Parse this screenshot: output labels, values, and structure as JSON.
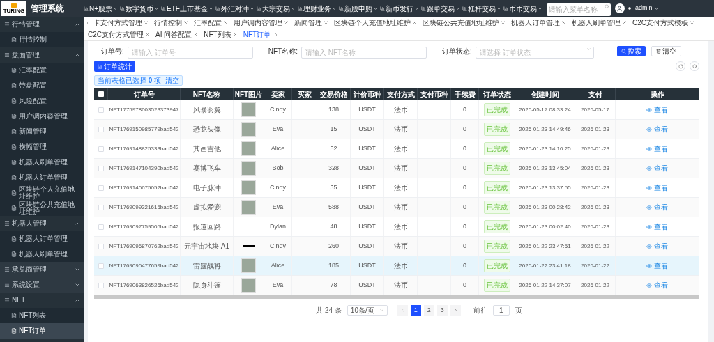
{
  "app": {
    "logo_text": "TURING",
    "title": "管理系统"
  },
  "top_nav": [
    {
      "label": "N+股票"
    },
    {
      "label": "数字货币"
    },
    {
      "label": "ETF上市基金"
    },
    {
      "label": "外汇对冲"
    },
    {
      "label": "大宗交易"
    },
    {
      "label": "理财业务"
    },
    {
      "label": "新股申购"
    },
    {
      "label": "新币发行"
    },
    {
      "label": "跟单交易"
    },
    {
      "label": "杠杆交易"
    },
    {
      "label": "币币交易"
    }
  ],
  "menu_search": {
    "placeholder": "请输入菜单名称"
  },
  "user": {
    "name": "admin"
  },
  "sidebar": {
    "items": [
      {
        "label": "行情管理",
        "expanded": true,
        "children": [
          {
            "label": "行情控制",
            "selected": false
          }
        ]
      },
      {
        "label": "盘面管理",
        "expanded": true,
        "children": [
          {
            "label": "汇率配置",
            "selected": false
          },
          {
            "label": "带盘配置",
            "selected": false
          },
          {
            "label": "风险配置",
            "selected": false
          },
          {
            "label": "用户调内容管理",
            "selected": false
          },
          {
            "label": "新闻管理",
            "selected": false
          },
          {
            "label": "横幅管理",
            "selected": false
          },
          {
            "label": "机器人刷单管理",
            "selected": false
          },
          {
            "label": "机器人订单管理",
            "selected": false
          },
          {
            "label": "区块链个人充值地址维护",
            "selected": false
          },
          {
            "label": "区块链公共充值地址维护",
            "selected": false
          }
        ]
      },
      {
        "label": "机器人管理",
        "expanded": true,
        "children": [
          {
            "label": "机器人订单管理",
            "selected": false
          },
          {
            "label": "机器人刷单管理",
            "selected": false
          }
        ]
      },
      {
        "label": "承兑商管理",
        "expanded": false
      },
      {
        "label": "系统设置",
        "expanded": false
      },
      {
        "label": "NFT",
        "expanded": true,
        "children": [
          {
            "label": "NFT列表",
            "selected": false
          },
          {
            "label": "NFT订单",
            "selected": true
          }
        ]
      }
    ]
  },
  "tabs": [
    {
      "label": "卡支付方式管理",
      "selected": false
    },
    {
      "label": "行情控制",
      "selected": false
    },
    {
      "label": "汇率配置",
      "selected": false
    },
    {
      "label": "用户调内容管理",
      "selected": false
    },
    {
      "label": "新闻管理",
      "selected": false
    },
    {
      "label": "区块链个人充值地址维护",
      "selected": false
    },
    {
      "label": "区块链公共充值地址维护",
      "selected": false
    },
    {
      "label": "机器人订单管理",
      "selected": false
    },
    {
      "label": "机器人刷单管理",
      "selected": false
    },
    {
      "label": "C2C支付方式模板",
      "selected": false
    },
    {
      "label": "C2C支付方式管理",
      "selected": false
    },
    {
      "label": "AI 问答配置",
      "selected": false
    },
    {
      "label": "NFT列表",
      "selected": false
    },
    {
      "label": "NFT订单",
      "selected": true
    }
  ],
  "filters": [
    {
      "label": "订单号:",
      "placeholder": "请输入 订单号",
      "kind": "input"
    },
    {
      "label": "NFT名称:",
      "placeholder": "请输入 NFT名称",
      "kind": "input"
    },
    {
      "label": "订单状态:",
      "placeholder": "请选择 订单状态",
      "kind": "select"
    }
  ],
  "buttons": {
    "search": "搜索",
    "reset": "清空",
    "stats": "订单统计"
  },
  "selection": {
    "text": "当前表格已选择 **0** 项",
    "clear": "清空"
  },
  "table": {
    "all_checked": false,
    "columns": [
      "订单号",
      "NFT名称",
      "NFT图片",
      "卖家",
      "买家",
      "交易价格",
      "计价币种",
      "支付方式",
      "支付币种",
      "手续费",
      "订单状态",
      "创建时间",
      "支付",
      "操作"
    ],
    "rows": [
      {
        "kind": "picture",
        "selected": false,
        "checked": false,
        "order_no": "NFT1775978003523373947",
        "name": "风暴羽翼",
        "seller": "Cindy",
        "price": "138",
        "currency": "USDT",
        "pay_method": "法币",
        "fee": "0",
        "status": "已完成",
        "created": "2026-05-17 08:33:24",
        "paid": "2026-05-17",
        "action": "查看"
      },
      {
        "kind": "picture",
        "selected": false,
        "checked": false,
        "order_no": "NFT1769150985779bad542",
        "name": "恐龙头像",
        "seller": "Eva",
        "price": "15",
        "currency": "USDT",
        "pay_method": "法币",
        "fee": "0",
        "status": "已完成",
        "created": "2026-01-23 14:49:46",
        "paid": "2026-01-23",
        "action": "查看"
      },
      {
        "kind": "picture",
        "selected": false,
        "checked": false,
        "order_no": "NFT1769148825333bad542",
        "name": "其画吉他",
        "seller": "Alice",
        "price": "52",
        "currency": "USDT",
        "pay_method": "法币",
        "fee": "0",
        "status": "已完成",
        "created": "2026-01-23 14:10:25",
        "paid": "2026-01-23",
        "action": "查看"
      },
      {
        "kind": "picture",
        "selected": false,
        "checked": false,
        "order_no": "NFT1769147104390bad542",
        "name": "赛博飞车",
        "seller": "Bob",
        "price": "328",
        "currency": "USDT",
        "pay_method": "法币",
        "fee": "0",
        "status": "已完成",
        "created": "2026-01-23 13:45:04",
        "paid": "2026-01-23",
        "action": "查看"
      },
      {
        "kind": "picture",
        "selected": false,
        "checked": false,
        "order_no": "NFT1769146675052bad542",
        "name": "电子脉冲",
        "seller": "Cindy",
        "price": "35",
        "currency": "USDT",
        "pay_method": "法币",
        "fee": "0",
        "status": "已完成",
        "created": "2026-01-23 13:37:55",
        "paid": "2026-01-23",
        "action": "查看"
      },
      {
        "kind": "picture",
        "selected": false,
        "checked": false,
        "order_no": "NFT1769099321615bad542",
        "name": "虚拟爱宠",
        "seller": "Eva",
        "price": "588",
        "currency": "USDT",
        "pay_method": "法币",
        "fee": "0",
        "status": "已完成",
        "created": "2026-01-23 00:28:42",
        "paid": "2026-01-23",
        "action": "查看"
      },
      {
        "kind": "blank",
        "selected": false,
        "checked": false,
        "order_no": "NFT1769097759505bad542",
        "name": "报道回路",
        "seller": "Dylan",
        "price": "48",
        "currency": "USDT",
        "pay_method": "法币",
        "fee": "0",
        "status": "已完成",
        "created": "2026-01-23 00:02:40",
        "paid": "2026-01-23",
        "action": "查看"
      },
      {
        "kind": "strip",
        "selected": false,
        "checked": false,
        "order_no": "NFT1769096870762bad542",
        "name": "元宇宙地块 A1",
        "seller": "Cindy",
        "price": "260",
        "currency": "USDT",
        "pay_method": "法币",
        "fee": "0",
        "status": "已完成",
        "created": "2026-01-22 23:47:51",
        "paid": "2026-01-22",
        "action": "查看"
      },
      {
        "kind": "picture",
        "selected": true,
        "checked": false,
        "order_no": "NFT1769096477659bad542",
        "name": "雷霆战将",
        "seller": "Alice",
        "price": "185",
        "currency": "USDT",
        "pay_method": "法币",
        "fee": "0",
        "status": "已完成",
        "created": "2026-01-22 23:41:18",
        "paid": "2026-01-22",
        "action": "查看"
      },
      {
        "kind": "picture",
        "selected": false,
        "checked": false,
        "order_no": "NFT1769063826526bad542",
        "name": "隐身斗篷",
        "seller": "Eva",
        "price": "78",
        "currency": "USDT",
        "pay_method": "法币",
        "fee": "0",
        "status": "已完成",
        "created": "2026-01-22 14:37:07",
        "paid": "2026-01-22",
        "action": "查看"
      }
    ]
  },
  "pagination": {
    "total": "共 24 条",
    "page_size": "10条/页",
    "pages": [
      {
        "label": "1",
        "selected": true
      },
      {
        "label": "2",
        "selected": false
      },
      {
        "label": "3",
        "selected": false
      }
    ],
    "goto_label": "前往",
    "goto_value": "1",
    "goto_suffix": "页"
  }
}
